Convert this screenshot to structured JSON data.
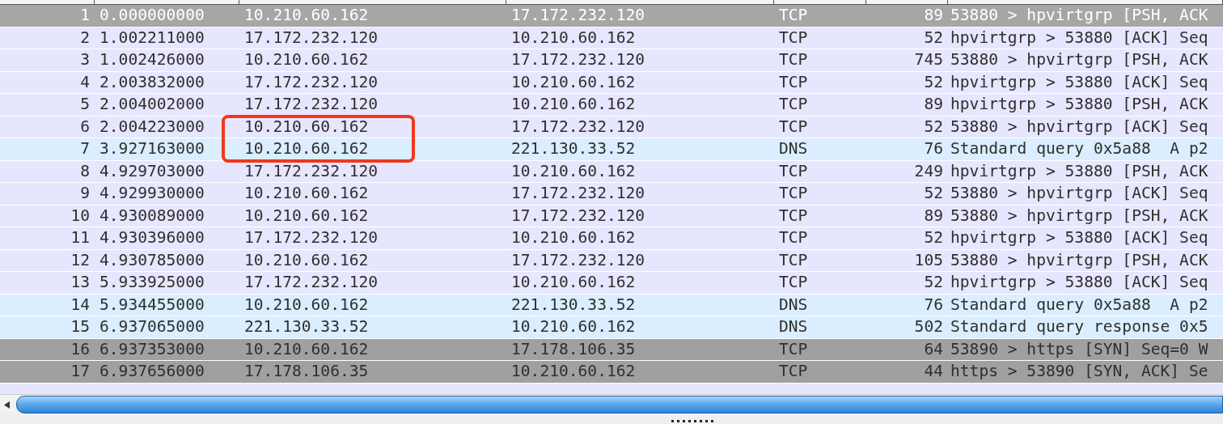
{
  "packet_list": {
    "rows": [
      {
        "no": "1",
        "time": "0.000000000",
        "source": "10.210.60.162",
        "destination": "17.172.232.120",
        "protocol": "TCP",
        "length": "89",
        "info": "53880 > hpvirtgrp [PSH, ACK",
        "color": "#a6a6a6",
        "selected": true
      },
      {
        "no": "2",
        "time": "1.002211000",
        "source": "17.172.232.120",
        "destination": "10.210.60.162",
        "protocol": "TCP",
        "length": "52",
        "info": "hpvirtgrp > 53880 [ACK] Seq",
        "color": "#e7e6ff",
        "selected": false
      },
      {
        "no": "3",
        "time": "1.002426000",
        "source": "10.210.60.162",
        "destination": "17.172.232.120",
        "protocol": "TCP",
        "length": "745",
        "info": "53880 > hpvirtgrp [PSH, ACK",
        "color": "#e7e6ff",
        "selected": false
      },
      {
        "no": "4",
        "time": "2.003832000",
        "source": "17.172.232.120",
        "destination": "10.210.60.162",
        "protocol": "TCP",
        "length": "52",
        "info": "hpvirtgrp > 53880 [ACK] Seq",
        "color": "#e7e6ff",
        "selected": false
      },
      {
        "no": "5",
        "time": "2.004002000",
        "source": "17.172.232.120",
        "destination": "10.210.60.162",
        "protocol": "TCP",
        "length": "89",
        "info": "hpvirtgrp > 53880 [PSH, ACK",
        "color": "#e7e6ff",
        "selected": false
      },
      {
        "no": "6",
        "time": "2.004223000",
        "source": "10.210.60.162",
        "destination": "17.172.232.120",
        "protocol": "TCP",
        "length": "52",
        "info": "53880 > hpvirtgrp [ACK] Seq",
        "color": "#e7e6ff",
        "selected": false
      },
      {
        "no": "7",
        "time": "3.927163000",
        "source": "10.210.60.162",
        "destination": "221.130.33.52",
        "protocol": "DNS",
        "length": "76",
        "info": "Standard query 0x5a88  A p2",
        "color": "#daeeff",
        "selected": false
      },
      {
        "no": "8",
        "time": "4.929703000",
        "source": "17.172.232.120",
        "destination": "10.210.60.162",
        "protocol": "TCP",
        "length": "249",
        "info": "hpvirtgrp > 53880 [PSH, ACK",
        "color": "#e7e6ff",
        "selected": false
      },
      {
        "no": "9",
        "time": "4.929930000",
        "source": "10.210.60.162",
        "destination": "17.172.232.120",
        "protocol": "TCP",
        "length": "52",
        "info": "53880 > hpvirtgrp [ACK] Seq",
        "color": "#e7e6ff",
        "selected": false
      },
      {
        "no": "10",
        "time": "4.930089000",
        "source": "10.210.60.162",
        "destination": "17.172.232.120",
        "protocol": "TCP",
        "length": "89",
        "info": "53880 > hpvirtgrp [PSH, ACK",
        "color": "#e7e6ff",
        "selected": false
      },
      {
        "no": "11",
        "time": "4.930396000",
        "source": "17.172.232.120",
        "destination": "10.210.60.162",
        "protocol": "TCP",
        "length": "52",
        "info": "hpvirtgrp > 53880 [ACK] Seq",
        "color": "#e7e6ff",
        "selected": false
      },
      {
        "no": "12",
        "time": "4.930785000",
        "source": "10.210.60.162",
        "destination": "17.172.232.120",
        "protocol": "TCP",
        "length": "105",
        "info": "53880 > hpvirtgrp [PSH, ACK",
        "color": "#e7e6ff",
        "selected": false
      },
      {
        "no": "13",
        "time": "5.933925000",
        "source": "17.172.232.120",
        "destination": "10.210.60.162",
        "protocol": "TCP",
        "length": "52",
        "info": "hpvirtgrp > 53880 [ACK] Seq",
        "color": "#e7e6ff",
        "selected": false
      },
      {
        "no": "14",
        "time": "5.934455000",
        "source": "10.210.60.162",
        "destination": "221.130.33.52",
        "protocol": "DNS",
        "length": "76",
        "info": "Standard query 0x5a88  A p2",
        "color": "#daeeff",
        "selected": false
      },
      {
        "no": "15",
        "time": "6.937065000",
        "source": "221.130.33.52",
        "destination": "10.210.60.162",
        "protocol": "DNS",
        "length": "502",
        "info": "Standard query response 0x5",
        "color": "#daeeff",
        "selected": false
      },
      {
        "no": "16",
        "time": "6.937353000",
        "source": "10.210.60.162",
        "destination": "17.178.106.35",
        "protocol": "TCP",
        "length": "64",
        "info": "53890 > https [SYN] Seq=0 W",
        "color": "#a0a0a0",
        "selected": false
      },
      {
        "no": "17",
        "time": "6.937656000",
        "source": "17.178.106.35",
        "destination": "10.210.60.162",
        "protocol": "TCP",
        "length": "44",
        "info": "https > 53890 [SYN, ACK] Se",
        "color": "#a0a0a0",
        "selected": false
      }
    ]
  }
}
